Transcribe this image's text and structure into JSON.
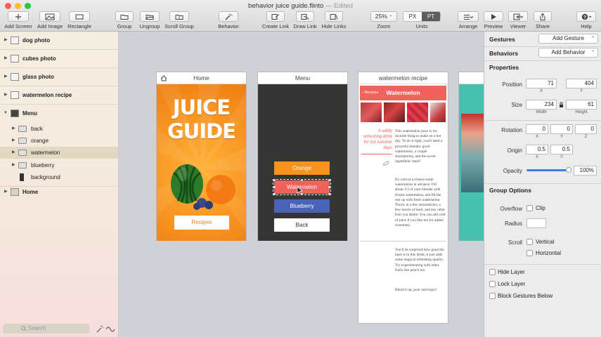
{
  "window": {
    "title": "behavior juice guide.flinto",
    "edited": "— Edited"
  },
  "toolbar": {
    "add_screen": "Add Screen",
    "add_image": "Add Image",
    "rectangle": "Rectangle",
    "group": "Group",
    "ungroup": "Ungroup",
    "scroll_group": "Scroll Group",
    "behavior": "Behavior",
    "create_link": "Create Link",
    "draw_link": "Draw Link",
    "hide_links": "Hide Links",
    "zoom_value": "25%",
    "zoom_label": "Zoom",
    "units_px": "PX",
    "units_pt": "PT",
    "units_label": "Units",
    "arrange": "Arrange",
    "preview": "Preview",
    "viewer": "Viewer",
    "share": "Share",
    "help": "Help"
  },
  "sidebar": {
    "items": [
      {
        "label": "dog photo"
      },
      {
        "label": "cubes photo"
      },
      {
        "label": "glass photo"
      },
      {
        "label": "watermelon recipe"
      },
      {
        "label": "Menu"
      },
      {
        "label": "back"
      },
      {
        "label": "orange"
      },
      {
        "label": "watermelon"
      },
      {
        "label": "blueberry"
      },
      {
        "label": "background"
      },
      {
        "label": "Home"
      }
    ],
    "search_placeholder": "Search"
  },
  "canvas": {
    "home": {
      "title": "Home",
      "headline_1": "JUICE",
      "headline_2": "GUIDE",
      "button": "Recipes"
    },
    "menu": {
      "title": "Menu",
      "buttons": [
        "Orange",
        "Watermelon",
        "Blueberry",
        "Back"
      ]
    },
    "recipe": {
      "title": "watermelon recipe",
      "bar_title": "Watermelon",
      "back": "‹ Recipes",
      "quote": "A wildly refreshing drink for hot summer days",
      "p1": "This watermelon juice is my favorite thing to make on a hot day. To do it right, you'll need a powerful blender, good watermelon, a couple strawberries, and the secret ingredient: basil!",
      "p2": "It's critical to freeze some watermelon in advance. Fill about 2/3 of your blender with frozen watermelon, and fill the rest up with fresh watermelon. Throw in a few strawberries, a few leaves of basil, and any other fruit you desire. You can add a bit of juice if you like too for added sweetness.",
      "p3": "You'll be surprised how good the basil is in this drink, it just adds some magical refreshing quality. Try experimenting with other fruits like peach too.",
      "p4": "Blend it up, pour and enjoy!"
    }
  },
  "panel": {
    "gestures": "Gestures",
    "add_gesture": "Add Gesture",
    "behaviors": "Behaviors",
    "add_behavior": "Add Behavior",
    "properties": "Properties",
    "position": "Position",
    "pos_x": "71",
    "pos_y": "404",
    "size": "Size",
    "width": "234",
    "height": "61",
    "width_label": "Width",
    "height_label": "Height",
    "rotation": "Rotation",
    "rot_x": "0",
    "rot_y": "0",
    "rot_z": "0",
    "origin": "Origin",
    "org_x": "0.5",
    "org_y": "0.5",
    "opacity": "Opacity",
    "opacity_value": "100%",
    "opacity_level": 1.0,
    "x": "X",
    "y": "Y",
    "z": "Z",
    "group_options": "Group Options",
    "overflow": "Overflow",
    "clip": "Clip",
    "radius": "Radius",
    "scroll": "Scroll",
    "vertical": "Vertical",
    "horizontal": "Horizontal",
    "hide_layer": "Hide Layer",
    "lock_layer": "Lock Layer",
    "block_gestures": "Block Gestures Below"
  },
  "colors": {
    "orange": "#f7931f",
    "coral": "#f2615b",
    "blueberry": "#4a63b8",
    "accent": "#3f7fdc"
  }
}
